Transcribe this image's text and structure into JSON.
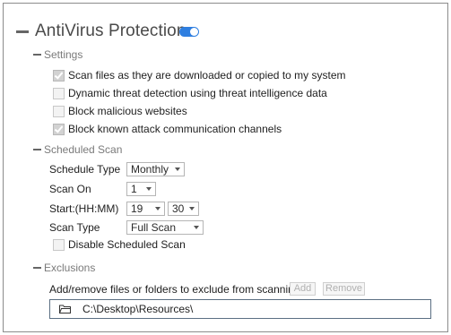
{
  "antivirus": {
    "title": "AntiVirus Protection",
    "enabled": true
  },
  "settings": {
    "title": "Settings",
    "options": [
      {
        "label": "Scan files as they are downloaded or copied to my system",
        "checked": true
      },
      {
        "label": "Dynamic threat detection using threat intelligence data",
        "checked": false
      },
      {
        "label": "Block malicious websites",
        "checked": false
      },
      {
        "label": "Block known attack communication channels",
        "checked": true
      }
    ]
  },
  "scheduled_scan": {
    "title": "Scheduled Scan",
    "schedule_type_label": "Schedule Type",
    "schedule_type_value": "Monthly",
    "scan_on_label": "Scan On",
    "scan_on_value": "1",
    "start_label": "Start:(HH:MM)",
    "start_hour": "19",
    "start_minute": "30",
    "scan_type_label": "Scan Type",
    "scan_type_value": "Full Scan",
    "disable_label": "Disable Scheduled Scan",
    "disable_checked": false
  },
  "exclusions": {
    "title": "Exclusions",
    "description": "Add/remove files or folders to exclude from scanning",
    "add_label": "Add",
    "remove_label": "Remove",
    "path": "C:\\Desktop\\Resources\\"
  },
  "colors": {
    "toggle_on": "#2f7fe0",
    "path_border": "#5b6f83"
  }
}
